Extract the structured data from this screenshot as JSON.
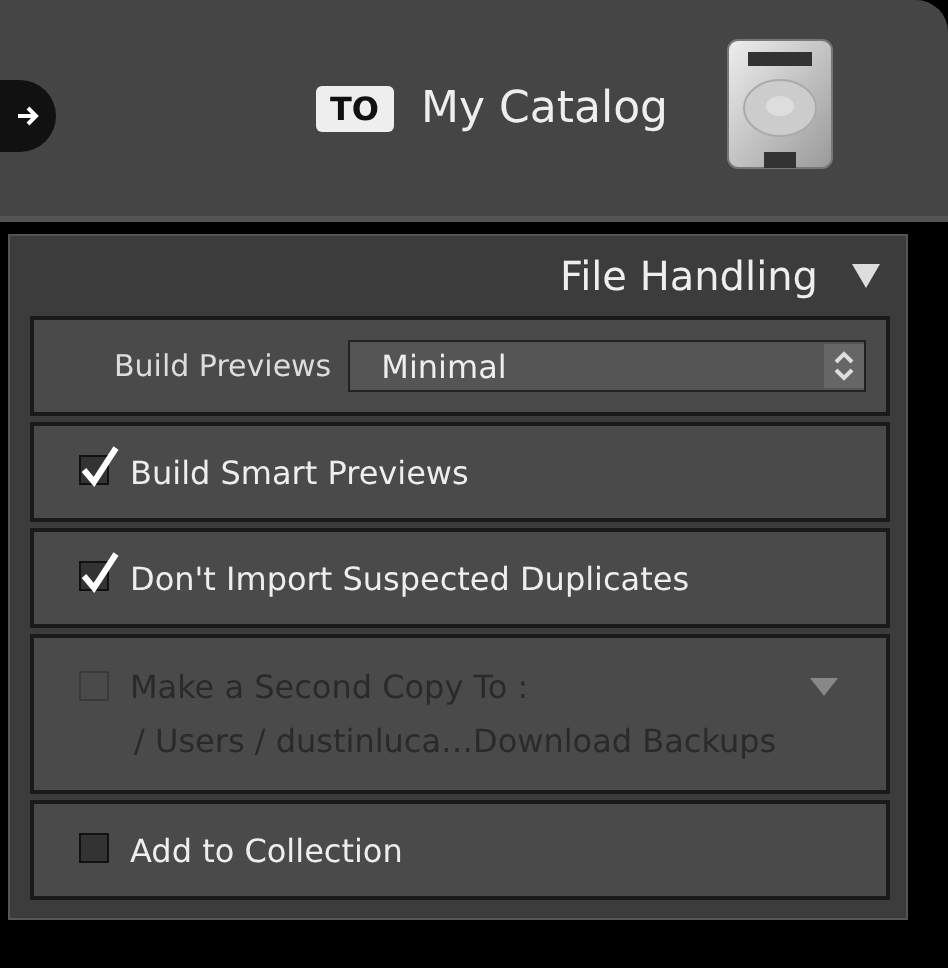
{
  "header": {
    "badge": "TO",
    "title": "My Catalog"
  },
  "panel": {
    "title": "File Handling",
    "expanded": true
  },
  "rows": [
    {
      "kind": "select",
      "label": "Build Previews",
      "value": "Minimal"
    },
    {
      "kind": "checkbox",
      "label": "Build Smart Previews",
      "checked": true,
      "disabled": false
    },
    {
      "kind": "checkbox",
      "label": "Don't Import Suspected Duplicates",
      "checked": true,
      "disabled": false
    },
    {
      "kind": "destination",
      "label": "Make a Second Copy To :",
      "path": "/ Users / dustinluca…Download Backups",
      "checked": false,
      "disabled": true
    },
    {
      "kind": "checkbox",
      "label": "Add to Collection",
      "checked": false,
      "disabled": false
    }
  ]
}
